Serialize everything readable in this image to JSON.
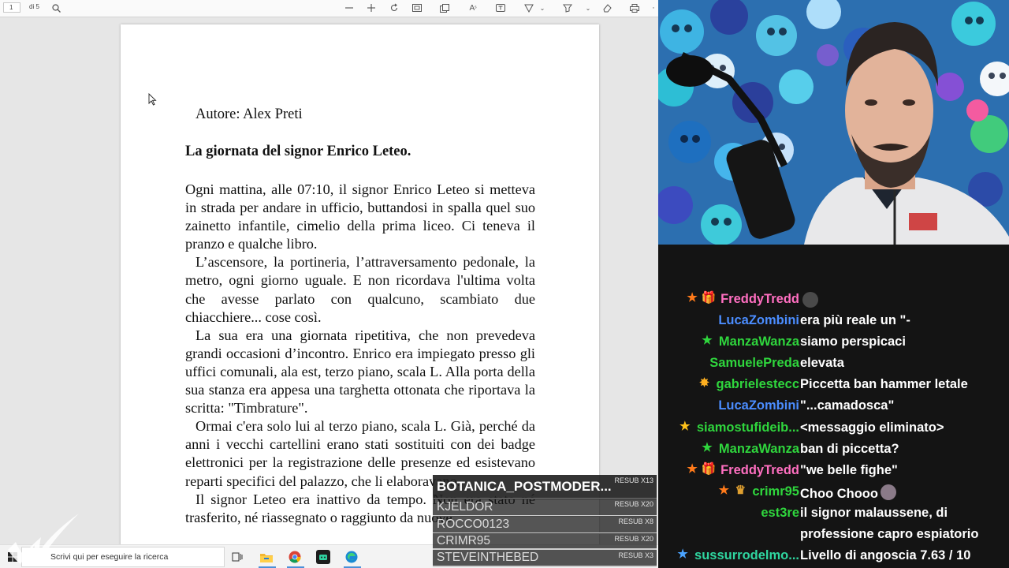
{
  "toolbar": {
    "page_number": "1",
    "page_total": "di 5",
    "icons": [
      "search-icon",
      "zoom-out-icon",
      "zoom-in-icon",
      "rotate-icon",
      "fit-page-icon",
      "page-view-icon",
      "read-aloud-icon",
      "text-box-icon",
      "draw-icon",
      "highlight-icon",
      "erase-icon",
      "print-icon"
    ]
  },
  "document": {
    "author": "Autore: Alex Preti",
    "title": "La giornata del signor Enrico Leteo.",
    "paragraphs": [
      "Ogni mattina, alle 07:10, il signor Enrico Leteo si metteva in strada per andare in ufficio, buttandosi in spalla quel suo zainetto infantile, cimelio della prima liceo. Ci teneva il pranzo e qualche libro.",
      "L’ascensore, la portineria, l’attraversamento pedonale, la metro, ogni giorno uguale. E non ricordava l'ultima volta che avesse parlato con qualcuno, scambiato due chiacchiere... cose così.",
      "La sua era una giornata ripetitiva, che non prevedeva grandi occasioni d’incontro. Enrico era impiegato presso gli uffici comunali, ala est, terzo piano, scala L. Alla porta della sua stanza era appesa una targhetta ottonata che riportava la scritta: \"Timbrature\".",
      "Ormai c'era solo lui al terzo piano, scala L. Già, perché da anni i vecchi cartellini erano stati sostituiti con dei badge elettronici per la registrazione delle presenze ed esistevano reparti specifici del palazzo, che li elaboravano.",
      "Il signor Leteo era inattivo da tempo. Non era stato né trasferito, né riassegnato o raggiunto da nuove"
    ]
  },
  "taskbar": {
    "search_placeholder": "Scrivi qui per eseguire la ricerca",
    "apps": [
      "task-view-icon",
      "file-explorer-icon",
      "chrome-icon",
      "app-icon",
      "edge-icon"
    ]
  },
  "resubs": [
    {
      "name": "BOTANICA_POSTMODER...",
      "count": "RESUB X13"
    },
    {
      "name": "KJELDOR",
      "count": "RESUB X20"
    },
    {
      "name": "ROCCO0123",
      "count": "RESUB X8"
    },
    {
      "name": "CRIMR95",
      "count": "RESUB X20"
    },
    {
      "name": "STEVEINTHEBED",
      "count": "RESUB X3"
    }
  ],
  "chat": {
    "colors": {
      "pink": "#ff69b4",
      "blue": "#3d8fff",
      "green": "#2ecc40",
      "orange": "#ff8c1a",
      "teal": "#1fd6a8"
    },
    "messages": [
      {
        "user": "FreddyTredd",
        "text": "",
        "color": "#ff6fc1",
        "badges": [
          "star-orange",
          "gift"
        ],
        "emote": "sunglasses-emote"
      },
      {
        "user": "LucaZombini",
        "text": "era più reale un \"-",
        "color": "#4b8dff",
        "badges": []
      },
      {
        "user": "ManzaWanza",
        "text": "siamo perspicaci",
        "color": "#2fd63d",
        "badges": [
          "star-green"
        ]
      },
      {
        "user": "SamuelePreda",
        "text": "elevata",
        "color": "#2fd63d",
        "badges": []
      },
      {
        "user": "gabrielestecc",
        "text": "Piccetta ban hammer letale",
        "color": "#2fd63d",
        "badges": [
          "burst"
        ]
      },
      {
        "user": "LucaZombini",
        "text": "\"...camadosca\"",
        "color": "#4b8dff",
        "badges": []
      },
      {
        "user": "siamostufideib...",
        "text": "<messaggio eliminato>",
        "color": "#2fd63d",
        "badges": [
          "star-yellow"
        ]
      },
      {
        "user": "ManzaWanza",
        "text": "ban di piccetta?",
        "color": "#2fd63d",
        "badges": [
          "star-green"
        ]
      },
      {
        "user": "FreddyTredd",
        "text": "\"we belle fighe\"",
        "color": "#ff6fc1",
        "badges": [
          "star-orange",
          "gift"
        ]
      },
      {
        "user": "crimr95",
        "text": "Choo Chooo",
        "color": "#2fd63d",
        "badges": [
          "star-orange",
          "crown"
        ],
        "emote": "train-emote"
      },
      {
        "user": "est3re",
        "text": "il signor malaussene, di",
        "color": "#2fd63d",
        "badges": []
      },
      {
        "user": "",
        "text": "professione capro espiatorio",
        "color": "#2fd63d",
        "badges": []
      },
      {
        "user": "sussurrodelmo...",
        "text": "Livello di angoscia 7.63 / 10",
        "color": "#2fd6a0",
        "badges": [
          "star-blue"
        ]
      }
    ]
  }
}
